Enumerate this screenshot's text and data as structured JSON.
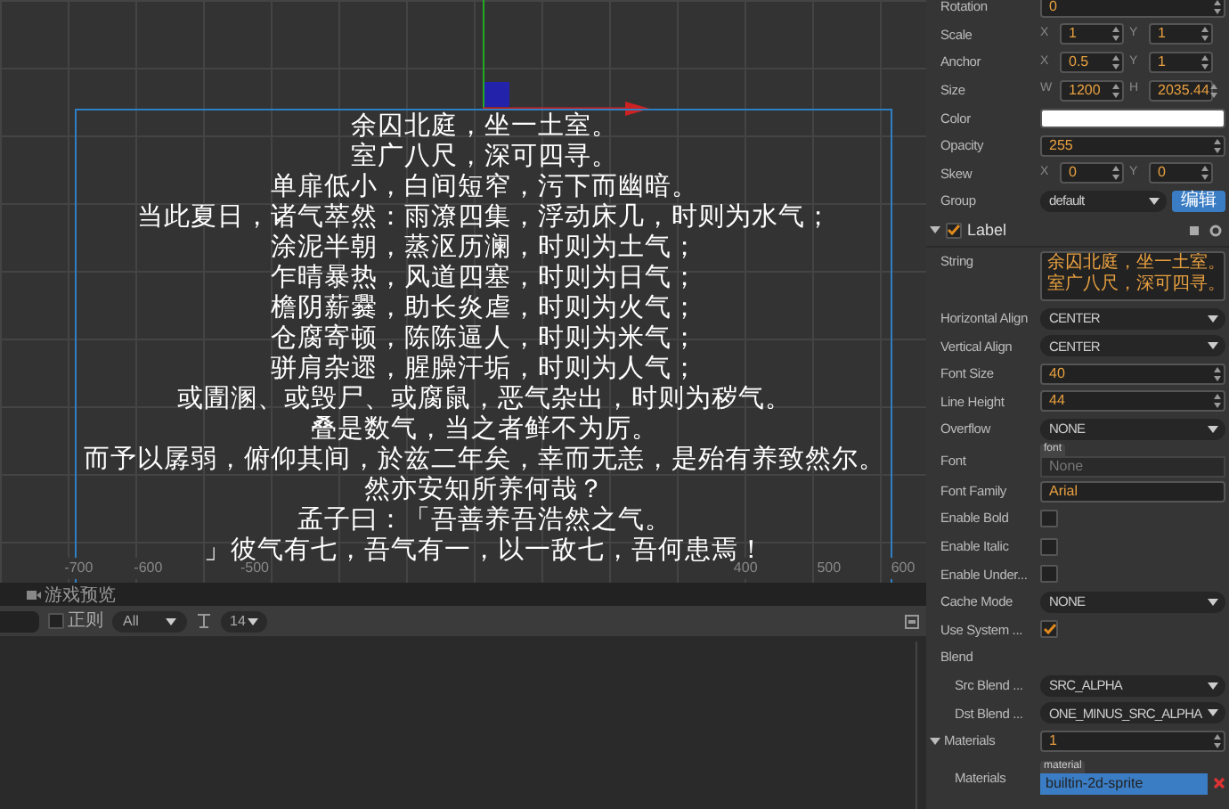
{
  "scene": {
    "lines": [
      "余囚北庭，坐一土室。",
      "室广八尺，深可四寻。",
      "单扉低小，白间短窄，污下而幽暗。",
      "当此夏日，诸气萃然：雨潦四集，浮动床几，时则为水气；",
      "涂泥半朝，蒸沤历澜，时则为土气；",
      "乍晴暴热，风道四塞，时则为日气；",
      "檐阴薪爨，助长炎虐，时则为火气；",
      "仓腐寄顿，陈陈逼人，时则为米气；",
      "骈肩杂遝，腥臊汗垢，时则为人气；",
      "或圊溷、或毁尸、或腐鼠，恶气杂出，时则为秽气。",
      "叠是数气，当之者鲜不为厉。",
      "而予以孱弱，俯仰其间，於兹二年矣，幸而无恙，是殆有养致然尔。",
      "然亦安知所养何哉？",
      "孟子曰：「吾善养吾浩然之气。",
      "」彼气有七，吾气有一，以一敌七，吾何患焉！"
    ],
    "ruler": [
      "-700",
      "-600",
      "-500",
      "400",
      "500",
      "600"
    ]
  },
  "console": {
    "tabs": [
      {
        "label": "游戏预览",
        "selected": false
      }
    ],
    "regex": {
      "label": "正则",
      "checked": false
    },
    "level_select": "All",
    "font_size_select": "14"
  },
  "inspector": {
    "rows": [
      {
        "kind": "number",
        "label": "Rotation",
        "value": "0"
      },
      {
        "kind": "xy",
        "label": "Scale",
        "axes": [
          "X",
          "Y"
        ],
        "values": [
          "1",
          "1"
        ]
      },
      {
        "kind": "xy",
        "label": "Anchor",
        "axes": [
          "X",
          "Y"
        ],
        "values": [
          "0.5",
          "1"
        ]
      },
      {
        "kind": "xy",
        "label": "Size",
        "axes": [
          "W",
          "H"
        ],
        "values": [
          "1200",
          "2035.44"
        ]
      },
      {
        "kind": "color",
        "label": "Color",
        "color": "#ffffff"
      },
      {
        "kind": "number",
        "label": "Opacity",
        "value": "255"
      },
      {
        "kind": "xy",
        "label": "Skew",
        "axes": [
          "X",
          "Y"
        ],
        "values": [
          "0",
          "0"
        ]
      },
      {
        "kind": "group",
        "label": "Group",
        "value": "default",
        "button": "编辑"
      },
      {
        "kind": "header",
        "label": "Label",
        "checked": true,
        "expanded": true
      },
      {
        "kind": "textarea",
        "label": "String",
        "lines": [
          "余囚北庭，坐一土室。",
          "室广八尺，深可四寻。"
        ]
      },
      {
        "kind": "select",
        "label": "Horizontal Align",
        "value": "CENTER"
      },
      {
        "kind": "select",
        "label": "Vertical Align",
        "value": "CENTER"
      },
      {
        "kind": "number",
        "label": "Font Size",
        "value": "40"
      },
      {
        "kind": "number",
        "label": "Line Height",
        "value": "44"
      },
      {
        "kind": "select",
        "label": "Overflow",
        "value": "NONE"
      },
      {
        "kind": "asset",
        "label": "Font",
        "tag": "font",
        "placeholder": "None"
      },
      {
        "kind": "text",
        "label": "Font Family",
        "value": "Arial"
      },
      {
        "kind": "checkbox",
        "label": "Enable Bold",
        "checked": false
      },
      {
        "kind": "checkbox",
        "label": "Enable Italic",
        "checked": false
      },
      {
        "kind": "checkbox",
        "label": "Enable Under...",
        "checked": false
      },
      {
        "kind": "select",
        "label": "Cache Mode",
        "value": "NONE"
      },
      {
        "kind": "checkbox",
        "label": "Use System ...",
        "checked": true
      },
      {
        "kind": "section",
        "label": "Blend",
        "children": [
          {
            "kind": "select",
            "label": "Src Blend ...",
            "value": "SRC_ALPHA"
          },
          {
            "kind": "select",
            "label": "Dst Blend ...",
            "value": "ONE_MINUS_SRC_ALPHA"
          }
        ]
      },
      {
        "kind": "count",
        "label": "Materials",
        "value": "1",
        "expanded": true,
        "children": [
          {
            "kind": "material",
            "label": "Materials",
            "tag": "material",
            "value": "builtin-2d-sprite"
          }
        ]
      }
    ]
  }
}
